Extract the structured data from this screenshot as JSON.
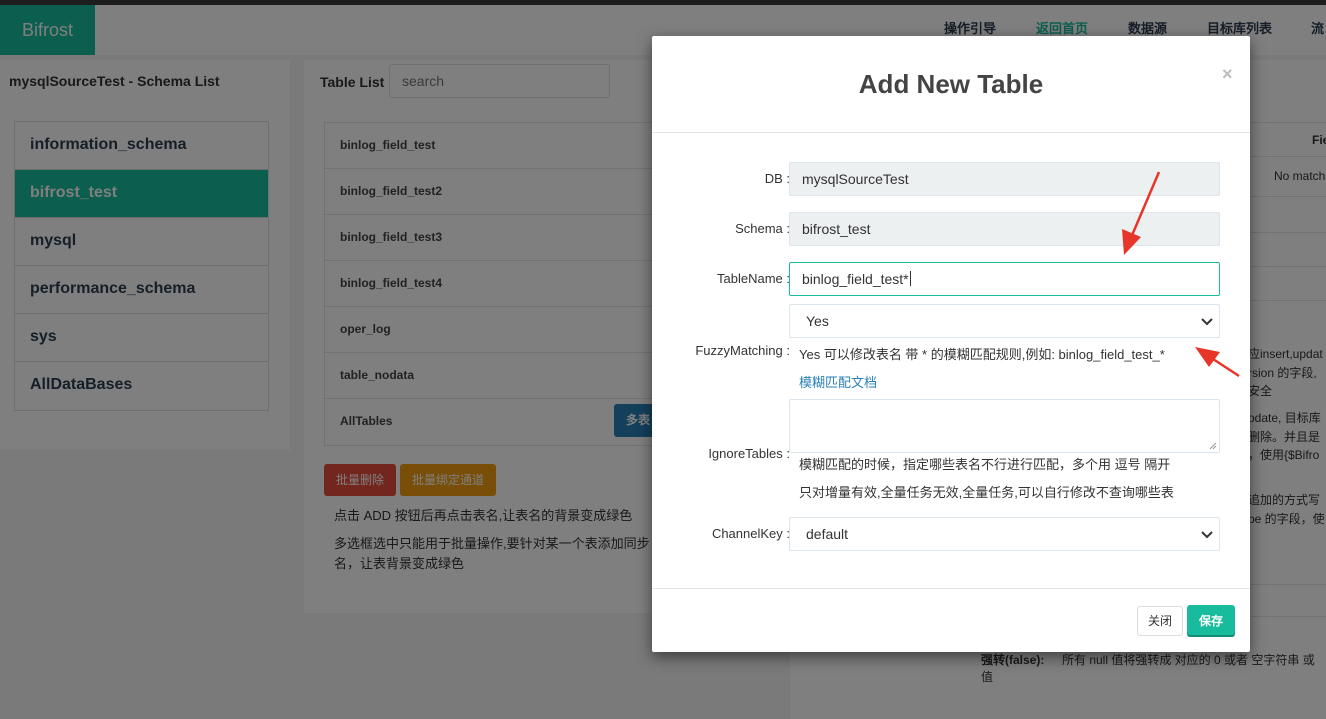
{
  "navbar": {
    "brand": "Bifrost",
    "links": [
      "操作引导",
      "返回首页",
      "数据源",
      "目标库列表",
      "流"
    ]
  },
  "schema_panel": {
    "title": "mysqlSourceTest - Schema List",
    "items": [
      "information_schema",
      "bifrost_test",
      "mysql",
      "performance_schema",
      "sys",
      "AllDataBases"
    ]
  },
  "table_panel": {
    "label": "Table List",
    "search_placeholder": "search",
    "items": [
      "binlog_field_test",
      "binlog_field_test2",
      "binlog_field_test3",
      "binlog_field_test4",
      "oper_log",
      "table_nodata",
      "AllTables"
    ],
    "multi_button": "多表",
    "batch_delete": "批量删除",
    "batch_bind": "批量绑定通道",
    "hint1": "点击 ADD 按钮后再点击表名,让表名的背景变成绿色",
    "hint2": "多选框选中只能用于批量操作,要针对某一个表添加同步",
    "hint2b": "名，让表背景变成绿色"
  },
  "right_panel": {
    "col_header": "Fie",
    "no_match": "No match",
    "t1": "应insert,updat",
    "t2": "rsion 的字段,",
    "t3": "安全",
    "t4": "odate, 目标库",
    "t5": "删除。并且是",
    "t6": "，使用{$Bifro",
    "t7": "追加的方式写",
    "t8": "pe 的字段，使",
    "strong_label": "强转(false):",
    "strong_text": "所有 null 值将强转成 对应的 0 或者 空字符串 或",
    "strong_text2": "值"
  },
  "modal": {
    "title": "Add New Table",
    "close_symbol": "×",
    "db_label": "DB",
    "db_value": "mysqlSourceTest",
    "schema_label": "Schema",
    "schema_value": "bifrost_test",
    "tablename_label": "TableName",
    "tablename_value": "binlog_field_test*",
    "fuzzy_label": "FuzzyMatching",
    "fuzzy_value": "Yes",
    "fuzzy_help": "Yes 可以修改表名 带 * 的模糊匹配规则,例如: binlog_field_test_*",
    "fuzzy_doc_link": "模糊匹配文档",
    "ignore_label": "IgnoreTables",
    "ignore_help1": "模糊匹配的时候，指定哪些表名不行进行匹配，多个用 逗号 隔开",
    "ignore_help2": "只对增量有效,全量任务无效,全量任务,可以自行修改不查询哪些表",
    "channel_label": "ChannelKey",
    "channel_value": "default",
    "close_button": "关闭",
    "save_button": "保存"
  },
  "colors": {
    "accent": "#18bc9c",
    "danger": "#e74c3c",
    "warning": "#f39c12",
    "primary": "#2980b9",
    "annotation_arrow": "#e8352a"
  }
}
